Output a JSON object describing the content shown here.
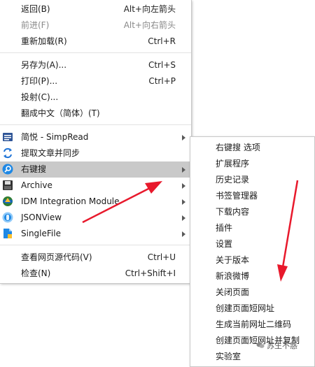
{
  "main_menu": {
    "items": [
      {
        "label": "返回(B)",
        "accel": "Alt+向左箭头",
        "disabled": false
      },
      {
        "label": "前进(F)",
        "accel": "Alt+向右箭头",
        "disabled": true
      },
      {
        "label": "重新加载(R)",
        "accel": "Ctrl+R",
        "disabled": false
      },
      {
        "label": "另存为(A)...",
        "accel": "Ctrl+S",
        "disabled": false
      },
      {
        "label": "打印(P)...",
        "accel": "Ctrl+P",
        "disabled": false
      },
      {
        "label": "投射(C)...",
        "accel": "",
        "disabled": false
      },
      {
        "label": "翻成中文（简体）(T)",
        "accel": "",
        "disabled": false
      }
    ],
    "extensions": [
      {
        "label": "简悦 - SimpRead",
        "icon": "simpread-icon",
        "submenu": true
      },
      {
        "label": "提取文章并同步",
        "icon": "sync-icon",
        "submenu": false
      },
      {
        "label": "右键搜",
        "icon": "search-extension-icon",
        "submenu": true,
        "highlighted": true
      },
      {
        "label": "Archive",
        "icon": "archive-icon",
        "submenu": true
      },
      {
        "label": "IDM Integration Module",
        "icon": "idm-icon",
        "submenu": true
      },
      {
        "label": "JSONView",
        "icon": "jsonview-icon",
        "submenu": true
      },
      {
        "label": "SingleFile",
        "icon": "singlefile-icon",
        "submenu": true
      }
    ],
    "bottom": [
      {
        "label": "查看网页源代码(V)",
        "accel": "Ctrl+U"
      },
      {
        "label": "检查(N)",
        "accel": "Ctrl+Shift+I"
      }
    ]
  },
  "sub_menu": {
    "items": [
      "右键搜 选项",
      "扩展程序",
      "历史记录",
      "书签管理器",
      "下载内容",
      "插件",
      "设置",
      "关于版本",
      "新浪微博",
      "关闭页面",
      "创建页面短网址",
      "生成当前网址二维码",
      "创建页面短网址并复制",
      "实验室"
    ]
  },
  "watermark": {
    "text": "苏生不惑",
    "icon": "wechat-icon"
  },
  "colors": {
    "highlight": "#c9c9c9",
    "annotation_arrow": "#e8192c",
    "disabled_text": "#8a8a8a"
  }
}
